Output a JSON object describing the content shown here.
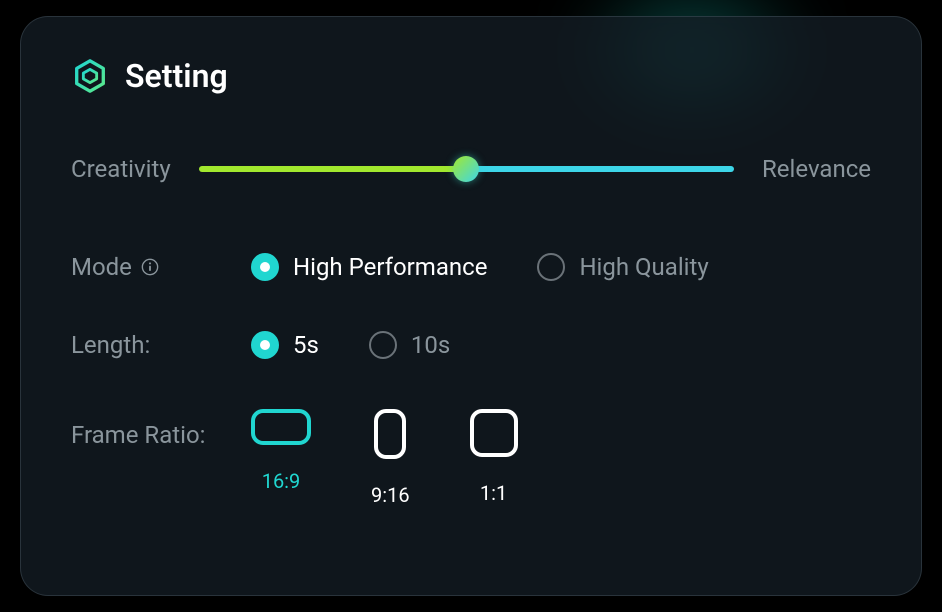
{
  "header": {
    "title": "Setting"
  },
  "slider": {
    "left_label": "Creativity",
    "right_label": "Relevance",
    "value": 50
  },
  "mode": {
    "label": "Mode",
    "options": [
      {
        "label": "High Performance",
        "selected": true
      },
      {
        "label": "High Quality",
        "selected": false
      }
    ]
  },
  "length": {
    "label": "Length:",
    "options": [
      {
        "label": "5s",
        "selected": true
      },
      {
        "label": "10s",
        "selected": false
      }
    ]
  },
  "frame_ratio": {
    "label": "Frame Ratio:",
    "options": [
      {
        "label": "16:9",
        "shape": "wide",
        "selected": true
      },
      {
        "label": "9:16",
        "shape": "tall",
        "selected": false
      },
      {
        "label": "1:1",
        "shape": "square",
        "selected": false
      }
    ]
  },
  "colors": {
    "accent": "#20d6d0",
    "slider_left": "#a2e82e",
    "slider_right": "#3dd6e8",
    "text_muted": "#8a959c",
    "text_primary": "#ffffff"
  }
}
